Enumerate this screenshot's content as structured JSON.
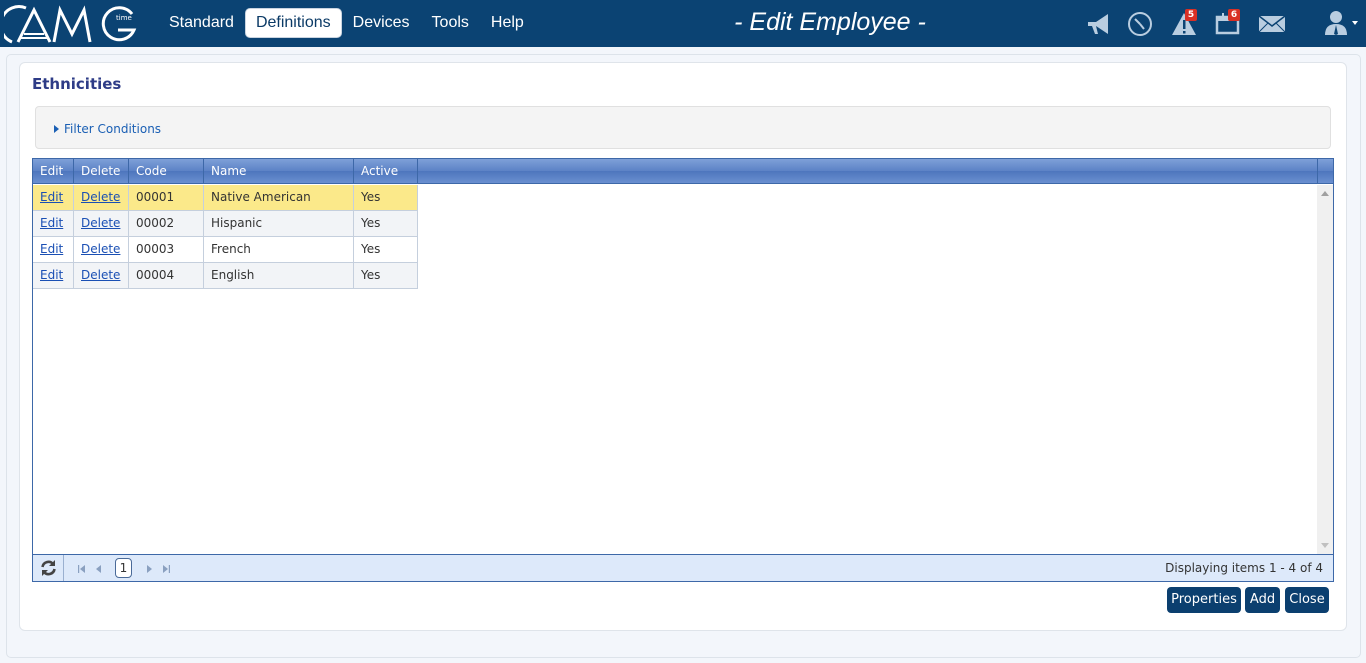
{
  "app": {
    "logo_text": "AMG",
    "logo_sub": "time",
    "page_title": "- Edit Employee -"
  },
  "nav": [
    {
      "label": "Standard",
      "active": false
    },
    {
      "label": "Definitions",
      "active": true
    },
    {
      "label": "Devices",
      "active": false
    },
    {
      "label": "Tools",
      "active": false
    },
    {
      "label": "Help",
      "active": false
    }
  ],
  "header_icons": [
    {
      "name": "megaphone-icon"
    },
    {
      "name": "clock-icon"
    },
    {
      "name": "alert-icon",
      "badge": "5"
    },
    {
      "name": "calendar-icon",
      "badge": "6"
    },
    {
      "name": "mail-icon"
    },
    {
      "name": "user-icon"
    }
  ],
  "section": {
    "title": "Ethnicities",
    "filter_label": "Filter Conditions"
  },
  "grid": {
    "columns": [
      "Edit",
      "Delete",
      "Code",
      "Name",
      "Active"
    ],
    "rows": [
      {
        "edit": "Edit",
        "delete": "Delete",
        "code": "00001",
        "name": "Native American",
        "active": "Yes",
        "selected": true
      },
      {
        "edit": "Edit",
        "delete": "Delete",
        "code": "00002",
        "name": "Hispanic",
        "active": "Yes"
      },
      {
        "edit": "Edit",
        "delete": "Delete",
        "code": "00003",
        "name": "French",
        "active": "Yes"
      },
      {
        "edit": "Edit",
        "delete": "Delete",
        "code": "00004",
        "name": "English",
        "active": "Yes"
      }
    ],
    "pager": {
      "current_page": "1",
      "info": "Displaying items 1 - 4 of 4"
    }
  },
  "buttons": {
    "properties": "Properties",
    "add": "Add",
    "close": "Close"
  },
  "colors": {
    "header_bg": "#0b4373",
    "title": "#2e3c87",
    "selected_row": "#fbe98a",
    "button_bg": "#0b3f6f",
    "badge": "#d93025"
  }
}
